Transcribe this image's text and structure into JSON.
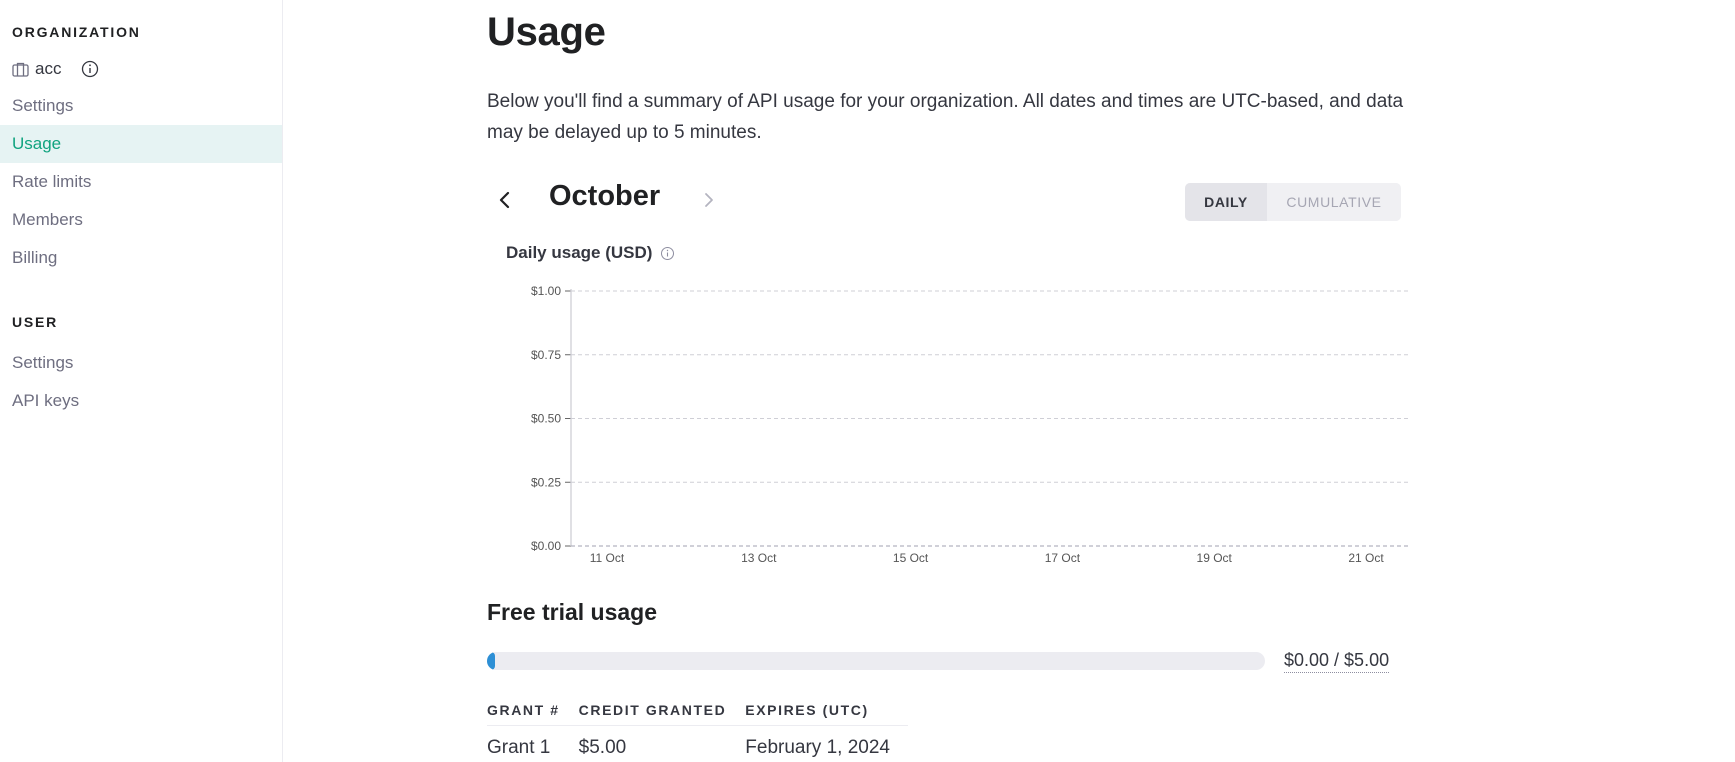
{
  "sidebar": {
    "org_heading": "ORGANIZATION",
    "org_name": "acc",
    "org_items": [
      {
        "label": "Settings",
        "active": false
      },
      {
        "label": "Usage",
        "active": true
      },
      {
        "label": "Rate limits",
        "active": false
      },
      {
        "label": "Members",
        "active": false
      },
      {
        "label": "Billing",
        "active": false
      }
    ],
    "user_heading": "USER",
    "user_items": [
      {
        "label": "Settings"
      },
      {
        "label": "API keys"
      }
    ]
  },
  "main": {
    "title": "Usage",
    "intro": "Below you'll find a summary of API usage for your organization. All dates and times are UTC-based, and data may be delayed up to 5 minutes.",
    "month": "October",
    "toggle": {
      "daily": "DAILY",
      "cumulative": "CUMULATIVE",
      "selected": "DAILY"
    },
    "chart_title": "Daily usage (USD)",
    "trial": {
      "title": "Free trial usage",
      "used_fraction": 0.0,
      "progress_text": "$0.00 / $5.00"
    },
    "grants_table": {
      "columns": [
        "GRANT #",
        "CREDIT GRANTED",
        "EXPIRES (UTC)"
      ],
      "rows": [
        [
          "Grant 1",
          "$5.00",
          "February 1, 2024"
        ]
      ]
    }
  },
  "colors": {
    "accent": "#10a37f",
    "active_bg": "#e6f3f3",
    "progress_fill": "#2d8fd5"
  },
  "chart_data": {
    "type": "bar",
    "title": "Daily usage (USD)",
    "xlabel": "",
    "ylabel": "",
    "x_ticks": [
      "11 Oct",
      "13 Oct",
      "15 Oct",
      "17 Oct",
      "19 Oct",
      "21 Oct"
    ],
    "y_ticks": [
      "$0.00",
      "$0.25",
      "$0.50",
      "$0.75",
      "$1.00"
    ],
    "ylim": [
      0,
      1.0
    ],
    "grid": true,
    "series": [
      {
        "values": [
          0,
          0,
          0,
          0,
          0,
          0,
          0,
          0,
          0,
          0,
          0,
          0
        ]
      }
    ]
  }
}
